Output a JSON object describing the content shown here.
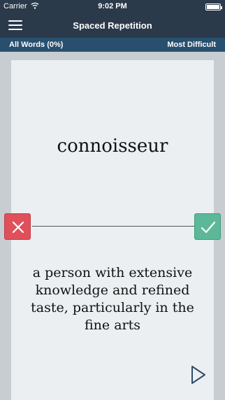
{
  "status_bar": {
    "carrier": "Carrier",
    "time": "9:02 PM",
    "wifi_icon": "wifi-icon",
    "battery_icon": "battery-icon"
  },
  "nav": {
    "menu_icon": "hamburger-menu-icon",
    "title": "Spaced Repetition"
  },
  "sub_bar": {
    "left_label": "All Words (0%)",
    "right_label": "Most Difficult"
  },
  "card": {
    "word": "connoisseur",
    "definition": "a person with extensive knowledge and refined taste, particularly in the fine arts",
    "wrong_icon": "close-icon",
    "right_icon": "checkmark-icon",
    "next_icon": "play-next-icon"
  },
  "colors": {
    "status_bar": "#2a3a4a",
    "sub_bar": "#28506e",
    "background": "#c8cdd1",
    "card": "#eceff1",
    "wrong": "#e0505a",
    "right": "#5cb898"
  }
}
